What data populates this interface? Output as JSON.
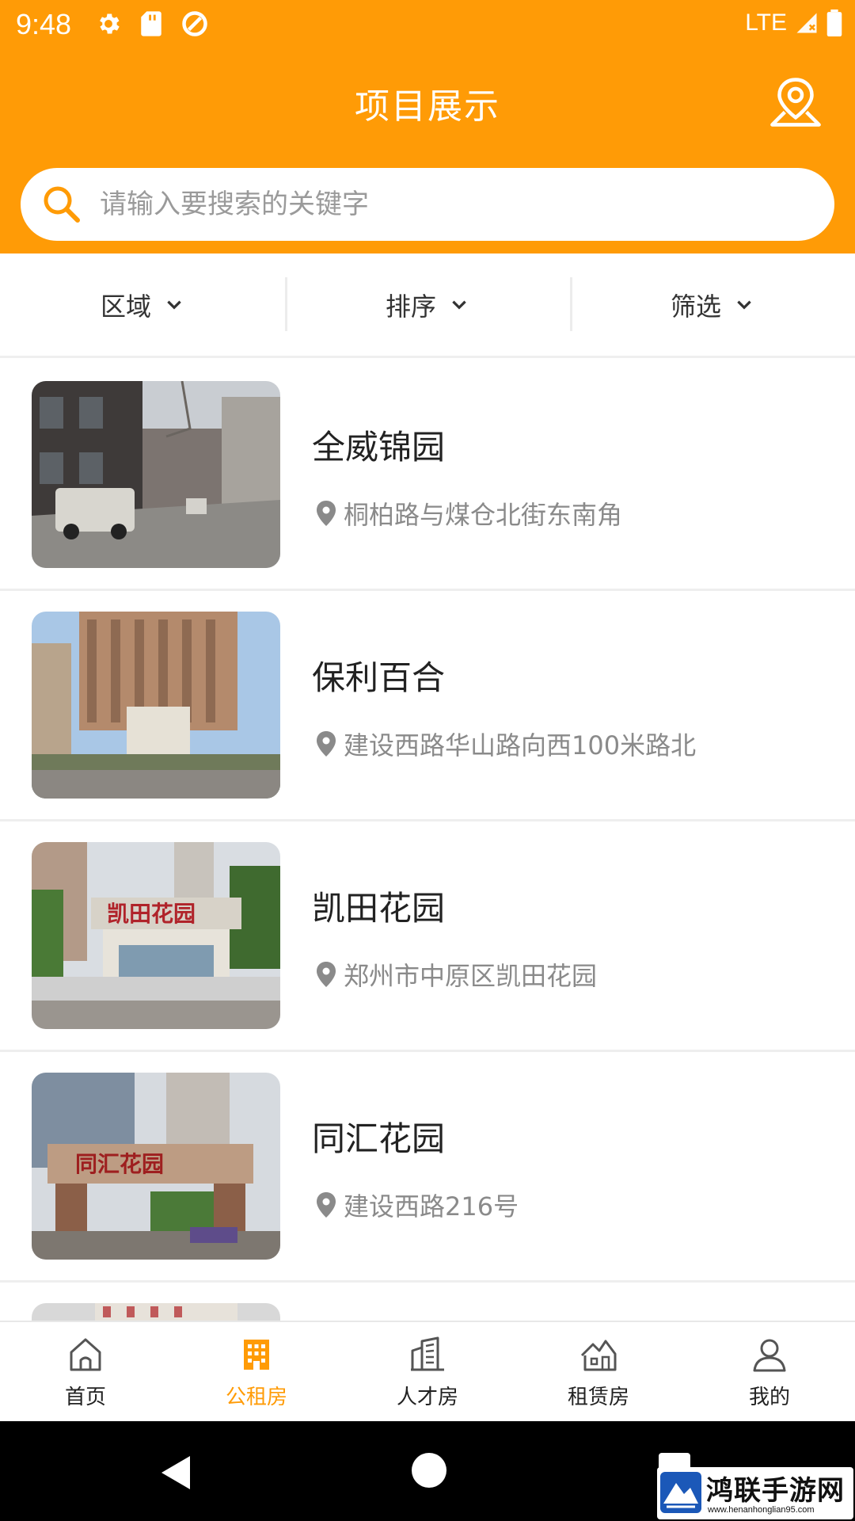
{
  "status_bar": {
    "time": "9:48",
    "network": "LTE",
    "icons": [
      "gear-icon",
      "sd-card-icon",
      "data-saver-icon",
      "signal-icon",
      "battery-icon"
    ]
  },
  "header": {
    "title": "项目展示",
    "location_icon": "location-map-icon"
  },
  "search": {
    "placeholder": "请输入要搜索的关键字",
    "value": ""
  },
  "filters": [
    {
      "label": "区域"
    },
    {
      "label": "排序"
    },
    {
      "label": "筛选"
    }
  ],
  "projects": [
    {
      "name": "全威锦园",
      "address": "桐柏路与煤仓北街东南角"
    },
    {
      "name": "保利百合",
      "address": "建设西路华山路向西100米路北"
    },
    {
      "name": "凯田花园",
      "address": "郑州市中原区凯田花园"
    },
    {
      "name": "同汇花园",
      "address": "建设西路216号"
    }
  ],
  "photo_signs": {
    "kaitian": "凯田花园",
    "tonghui": "同汇花园"
  },
  "tabs": [
    {
      "label": "首页",
      "icon": "home-icon",
      "active": false
    },
    {
      "label": "公租房",
      "icon": "building-icon",
      "active": true
    },
    {
      "label": "人才房",
      "icon": "office-tower-icon",
      "active": false
    },
    {
      "label": "租赁房",
      "icon": "house-icon",
      "active": false
    },
    {
      "label": "我的",
      "icon": "user-icon",
      "active": false
    }
  ],
  "watermark": {
    "title": "鸿联手游网",
    "url": "www.henanhonglian95.com"
  },
  "colors": {
    "accent": "#ff9b06",
    "text_secondary": "#8a8a8a"
  }
}
